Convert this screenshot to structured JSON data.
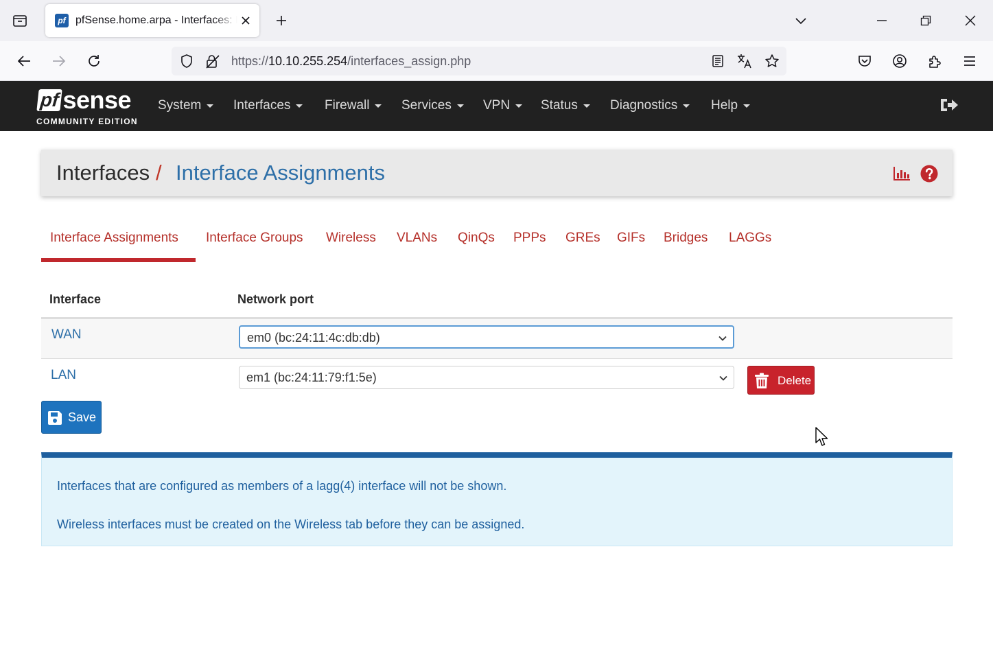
{
  "browser": {
    "tab_title": "pfSense.home.arpa - Interfaces: Interface Assignments",
    "favicon_text": "pf",
    "url_prefix": "https://",
    "url_host": "10.10.255.254",
    "url_path": "/interfaces_assign.php"
  },
  "app": {
    "brand_logo": "pf",
    "brand_sense": "sense",
    "brand_edition": "COMMUNITY EDITION",
    "menu": [
      "System",
      "Interfaces",
      "Firewall",
      "Services",
      "VPN",
      "Status",
      "Diagnostics",
      "Help"
    ]
  },
  "breadcrumb": {
    "parent": "Interfaces",
    "separator": "/",
    "current": "Interface Assignments"
  },
  "subtabs": [
    "Interface Assignments",
    "Interface Groups",
    "Wireless",
    "VLANs",
    "QinQs",
    "PPPs",
    "GREs",
    "GIFs",
    "Bridges",
    "LAGGs"
  ],
  "active_subtab": "Interface Assignments",
  "table": {
    "headers": [
      "Interface",
      "Network port"
    ],
    "rows": [
      {
        "interface": "WAN",
        "port": "em0 (bc:24:11:4c:db:db)"
      },
      {
        "interface": "LAN",
        "port": "em1 (bc:24:11:79:f1:5e)",
        "action": "Delete"
      }
    ]
  },
  "save_label": "Save",
  "info": [
    "Interfaces that are configured as members of a lagg(4) interface will not be shown.",
    "Wireless interfaces must be created on the Wireless tab before they can be assigned."
  ],
  "colors": {
    "nav_bg": "#212121",
    "link_blue": "#2d6fa8",
    "tab_red": "#b5302a",
    "delete_red": "#c8232c",
    "save_blue": "#1e73be",
    "info_bg": "#e3f4fb"
  }
}
